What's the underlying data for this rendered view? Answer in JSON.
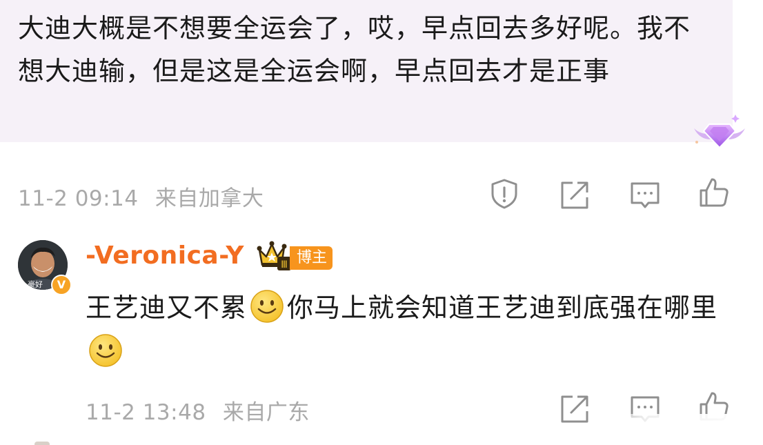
{
  "top_comment": {
    "text": "大迪大概是不想要全运会了，哎，早点回去多好呢。我不想大迪输，但是这是全运会啊，早点回去才是正事",
    "timestamp": "11-2 09:14",
    "location": "来自加拿大",
    "actions": [
      "report-icon",
      "share-icon",
      "comment-icon",
      "like-icon"
    ]
  },
  "reply": {
    "username": "-Veronica-Y",
    "badge_label": "博主",
    "crown_level": "Ⅲ",
    "verified_mark": "V",
    "avatar_caption": "豪好",
    "text_part1": "王艺迪又不累",
    "text_part2": "你马上就会知道王艺迪到底强在哪里",
    "timestamp": "11-2 13:48",
    "location": "来自广东",
    "actions": [
      "share-icon",
      "comment-icon",
      "like-icon"
    ]
  },
  "colors": {
    "username": "#f26d21",
    "badge": "#f7941d",
    "meta_text": "#a9a9a9",
    "bubble_bg": "#f6f1f8",
    "icon_stroke": "#8f8f8f"
  }
}
